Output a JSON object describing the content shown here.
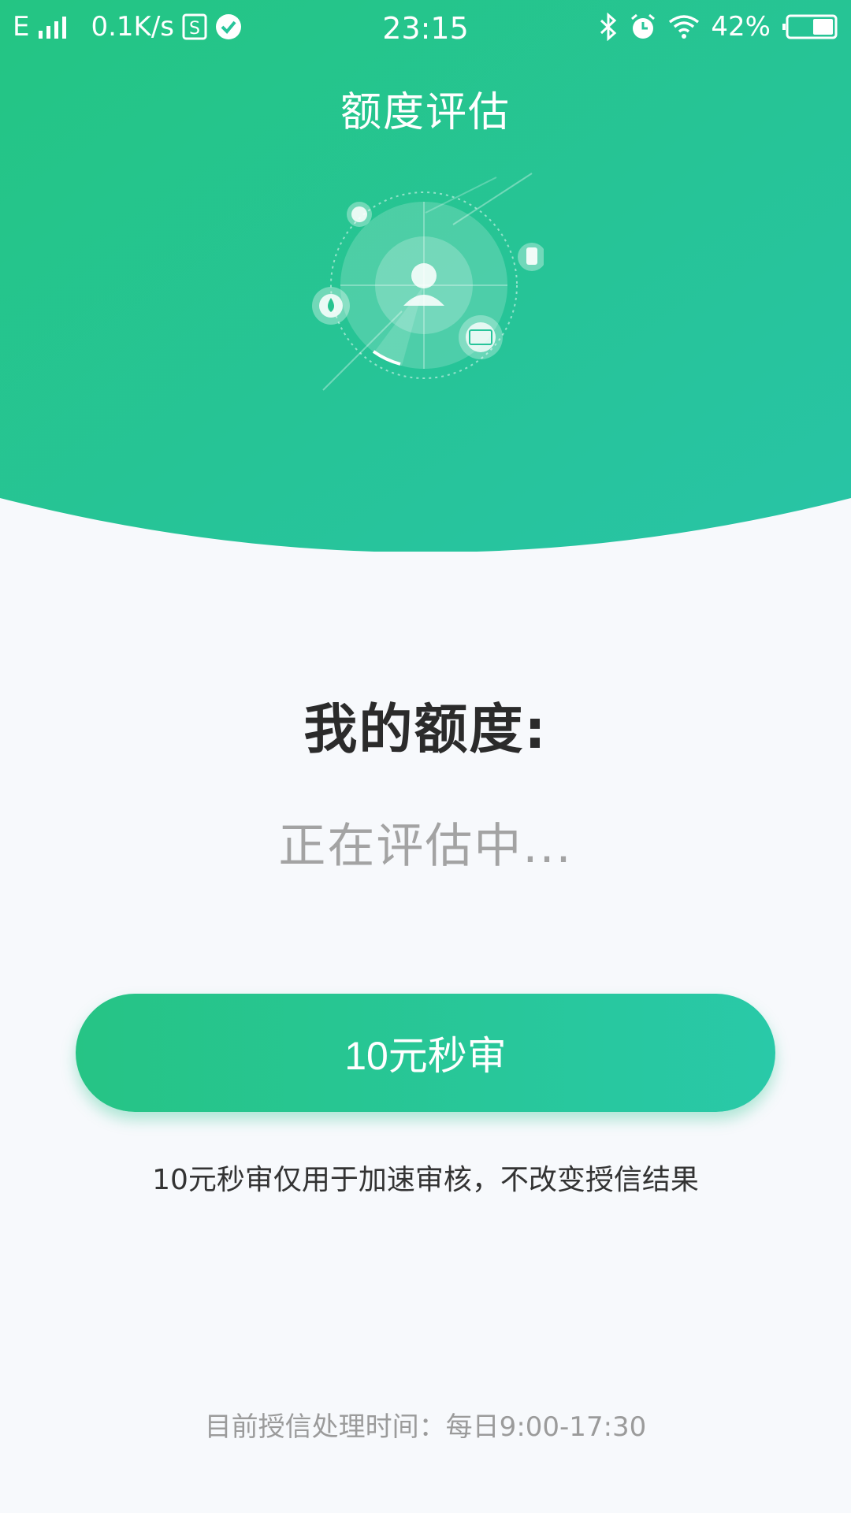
{
  "status_bar": {
    "network_type": "E",
    "speed": "0.1K/s",
    "time": "23:15",
    "battery": "42%",
    "icons": [
      "signal-icon",
      "sim-icon",
      "check-icon",
      "bluetooth-icon",
      "alarm-icon",
      "wifi-icon",
      "battery-icon"
    ]
  },
  "header": {
    "title": "额度评估"
  },
  "quota": {
    "label": "我的额度:",
    "status": "正在评估中..."
  },
  "action": {
    "button_label": "10元秒审",
    "note": "10元秒审仅用于加速审核，不改变授信结果"
  },
  "footer": {
    "hours_text": "目前授信处理时间：每日9:00-17:30"
  },
  "colors": {
    "brand_green": "#26c485",
    "brand_teal": "#29c9a8",
    "background": "#f7f9fc"
  }
}
